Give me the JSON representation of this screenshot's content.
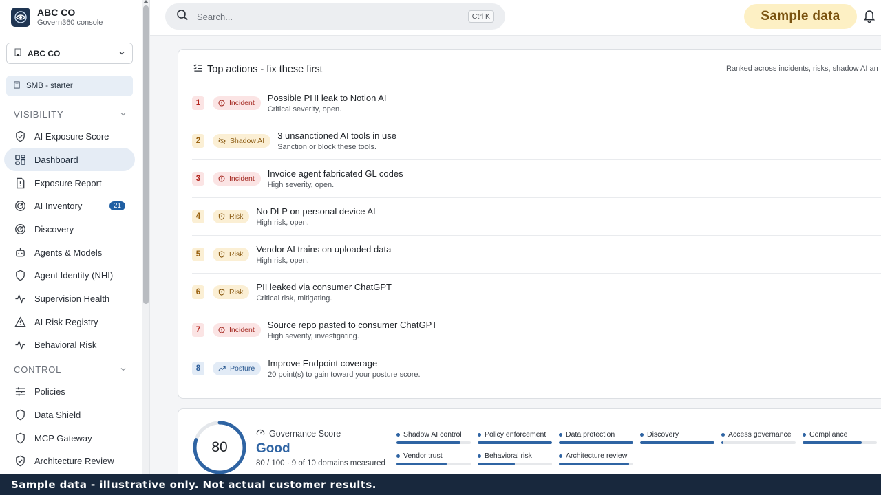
{
  "brand": {
    "org": "ABC CO",
    "subtitle": "Govern360 console",
    "icon": "eye-logo-icon"
  },
  "org_selector": {
    "value": "ABC CO",
    "icon": "building-icon"
  },
  "plan": {
    "label": "SMB - starter",
    "icon": "building-icon"
  },
  "sections": {
    "visibility": "VISIBILITY",
    "control": "CONTROL"
  },
  "nav": [
    {
      "label": "AI Exposure Score",
      "icon": "shield-check-icon"
    },
    {
      "label": "Dashboard",
      "icon": "grid-icon",
      "active": true
    },
    {
      "label": "Exposure Report",
      "icon": "file-alert-icon"
    },
    {
      "label": "AI Inventory",
      "icon": "radar-icon",
      "badge": "21"
    },
    {
      "label": "Discovery",
      "icon": "radar-icon"
    },
    {
      "label": "Agents & Models",
      "icon": "bot-icon"
    },
    {
      "label": "Agent Identity (NHI)",
      "icon": "shield-check-icon"
    },
    {
      "label": "Supervision Health",
      "icon": "pulse-icon"
    },
    {
      "label": "AI Risk Registry",
      "icon": "warning-icon"
    },
    {
      "label": "Behavioral Risk",
      "icon": "pulse-icon"
    }
  ],
  "nav_control": [
    {
      "label": "Policies",
      "icon": "sliders-icon"
    },
    {
      "label": "Data Shield",
      "icon": "shield-icon"
    },
    {
      "label": "MCP Gateway",
      "icon": "shield-icon"
    },
    {
      "label": "Architecture Review",
      "icon": "shield-check-icon"
    }
  ],
  "search": {
    "placeholder": "Search...",
    "shortcut": "Ctrl K"
  },
  "sample_pill": "Sample data",
  "actions": {
    "title": "Top actions - fix these first",
    "note": "Ranked across incidents, risks, shadow AI an",
    "items": [
      {
        "n": "1",
        "tag": "Incident",
        "kind": "incident",
        "title": "Possible PHI leak to Notion AI",
        "sub": "Critical severity, open."
      },
      {
        "n": "2",
        "tag": "Shadow AI",
        "kind": "shadow",
        "title": "3 unsanctioned AI tools in use",
        "sub": "Sanction or block these tools."
      },
      {
        "n": "3",
        "tag": "Incident",
        "kind": "incident",
        "title": "Invoice agent fabricated GL codes",
        "sub": "High severity, open."
      },
      {
        "n": "4",
        "tag": "Risk",
        "kind": "risk",
        "title": "No DLP on personal device AI",
        "sub": "High risk, open."
      },
      {
        "n": "5",
        "tag": "Risk",
        "kind": "risk",
        "title": "Vendor AI trains on uploaded data",
        "sub": "High risk, open."
      },
      {
        "n": "6",
        "tag": "Risk",
        "kind": "risk",
        "title": "PII leaked via consumer ChatGPT",
        "sub": "Critical risk, mitigating."
      },
      {
        "n": "7",
        "tag": "Incident",
        "kind": "incident",
        "title": "Source repo pasted to consumer ChatGPT",
        "sub": "High severity, investigating."
      },
      {
        "n": "8",
        "tag": "Posture",
        "kind": "posture",
        "title": "Improve Endpoint coverage",
        "sub": "20 point(s) to gain toward your posture score."
      }
    ]
  },
  "governance": {
    "score": "80",
    "score_fraction": 0.8,
    "title": "Governance Score",
    "grade": "Good",
    "meta": "80 / 100 · 9 of 10 domains measured",
    "domains": [
      {
        "label": "Shadow AI control",
        "fraction": 0.86
      },
      {
        "label": "Policy enforcement",
        "fraction": 1.0
      },
      {
        "label": "Data protection",
        "fraction": 1.0
      },
      {
        "label": "Discovery",
        "fraction": 1.0
      },
      {
        "label": "Access governance",
        "fraction": 0.03
      },
      {
        "label": "Compliance",
        "fraction": 0.8
      },
      {
        "label": "Vendor trust",
        "fraction": 0.68
      },
      {
        "label": "Behavioral risk",
        "fraction": 0.5
      },
      {
        "label": "Architecture review",
        "fraction": 0.94
      }
    ]
  },
  "banner": "Sample data - illustrative only. Not actual customer results.",
  "colors": {
    "accent": "#2f64a3",
    "banner": "#18283d",
    "sample_pill_bg": "#fdf0c4"
  }
}
